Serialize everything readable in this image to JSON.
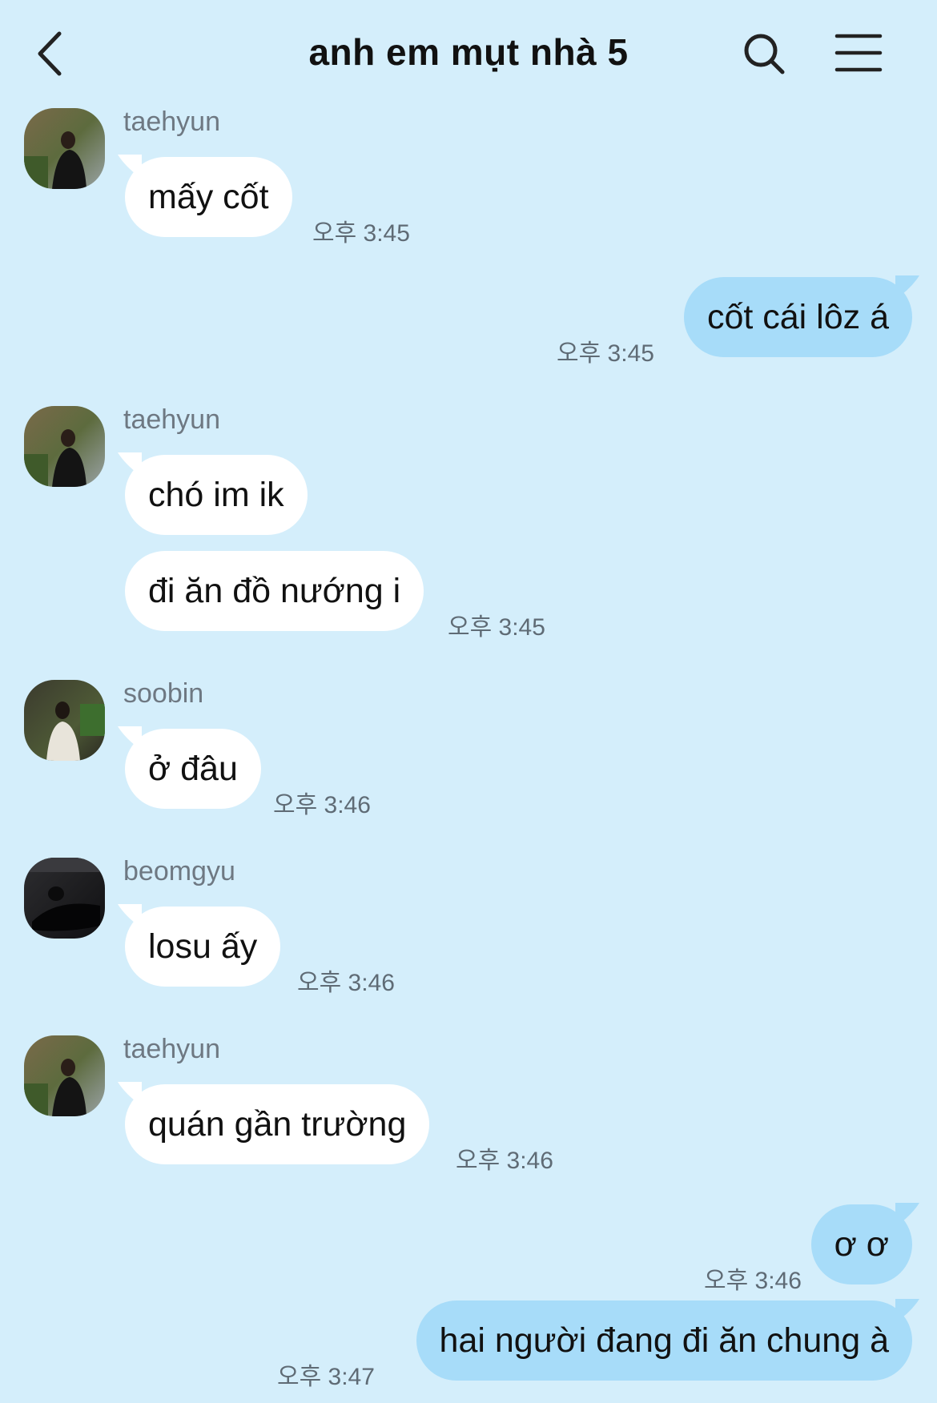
{
  "header": {
    "title": "anh em mụt nhà 5"
  },
  "senders": {
    "taehyun": "taehyun",
    "soobin": "soobin",
    "beomgyu": "beomgyu"
  },
  "messages": {
    "m1": {
      "text": "mấy cốt",
      "time": "오후 3:45"
    },
    "m2": {
      "text": "cốt cái lôz á",
      "time": "오후 3:45"
    },
    "m3": {
      "text": "chó im ik"
    },
    "m4": {
      "text": "đi ăn đồ nướng i",
      "time": "오후 3:45"
    },
    "m5": {
      "text": "ở đâu",
      "time": "오후 3:46"
    },
    "m6": {
      "text": "losu ấy",
      "time": "오후 3:46"
    },
    "m7": {
      "text": "quán gần trường",
      "time": "오후 3:46"
    },
    "m8": {
      "text": "ơ ơ",
      "time": "오후 3:46"
    },
    "m9": {
      "text": "hai người đang đi ăn chung à",
      "time": "오후 3:47"
    }
  },
  "colors": {
    "background": "#d4eefb",
    "incoming_bubble": "#ffffff",
    "outgoing_bubble": "#a7dcf9"
  },
  "icons": {
    "back": "chevron-left-icon",
    "search": "search-icon",
    "menu": "hamburger-menu-icon"
  }
}
